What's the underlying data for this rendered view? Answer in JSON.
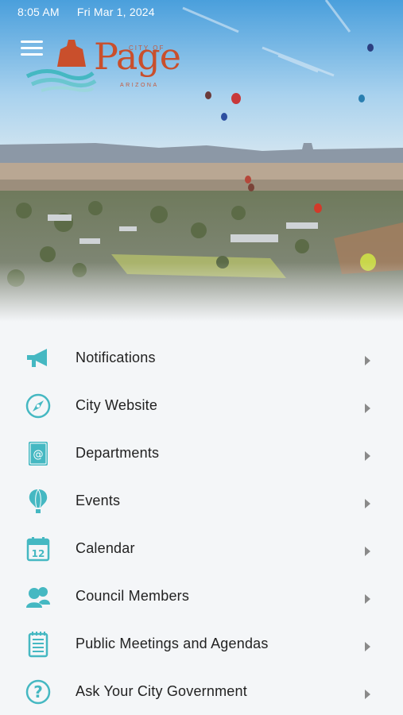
{
  "status_bar": {
    "time": "8:05 AM",
    "date": "Fri Mar 1, 2024"
  },
  "logo": {
    "city_of": "CITY OF",
    "name": "Page",
    "state": "ARIZONA"
  },
  "colors": {
    "accent": "#45b8c2",
    "logo_red": "#c94f2c",
    "background": "#f4f6f8"
  },
  "menu": {
    "items": [
      {
        "label": "Notifications",
        "icon": "megaphone-icon"
      },
      {
        "label": "City Website",
        "icon": "compass-icon"
      },
      {
        "label": "Departments",
        "icon": "directory-icon"
      },
      {
        "label": "Events",
        "icon": "hot-air-balloon-icon"
      },
      {
        "label": "Calendar",
        "icon": "calendar-icon"
      },
      {
        "label": "Council Members",
        "icon": "people-icon"
      },
      {
        "label": "Public Meetings and Agendas",
        "icon": "document-icon"
      },
      {
        "label": "Ask Your City Government",
        "icon": "question-icon"
      }
    ]
  }
}
